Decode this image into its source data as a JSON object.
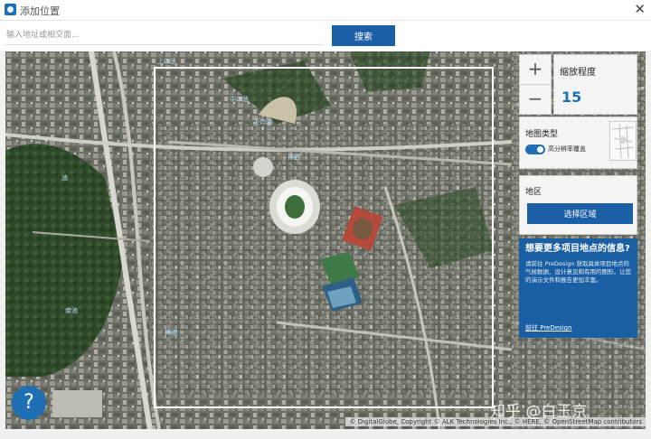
{
  "window": {
    "title": "添加位置",
    "close_icon": "close-icon"
  },
  "search": {
    "placeholder": "输入地址或相交面...",
    "value": "",
    "button_label": "搜索"
  },
  "map": {
    "labels": [
      "上の池",
      "中の池",
      "下の池",
      "池",
      "南池",
      "神池",
      "神宫"
    ]
  },
  "zoom": {
    "in_label": "+",
    "out_label": "−",
    "label": "缩放程度",
    "value": "15"
  },
  "map_type": {
    "label": "地图类型",
    "toggle_label": "高分辨率覆盖",
    "toggle_on": true
  },
  "region": {
    "label": "地区",
    "button_label": "选择区域"
  },
  "promo": {
    "title": "想要更多项目地点的信息?",
    "body": "请前往 PreDesign 获取具体项目地点的气候数据、设计意见和有用的图形。让您的演示文件和报告更加丰富。",
    "link": "前往 PreDesign"
  },
  "help": {
    "label": "?"
  },
  "watermark": "知乎 @白玉京",
  "attribution": "© DigitalGlobe, Copyright © ALK Technologies Inc., © HERE, © OpenStreetMap contributors",
  "colors": {
    "accent": "#1b5fa6",
    "promo_bg": "#1a5ea3",
    "zoom_value": "#1f6fb5"
  }
}
